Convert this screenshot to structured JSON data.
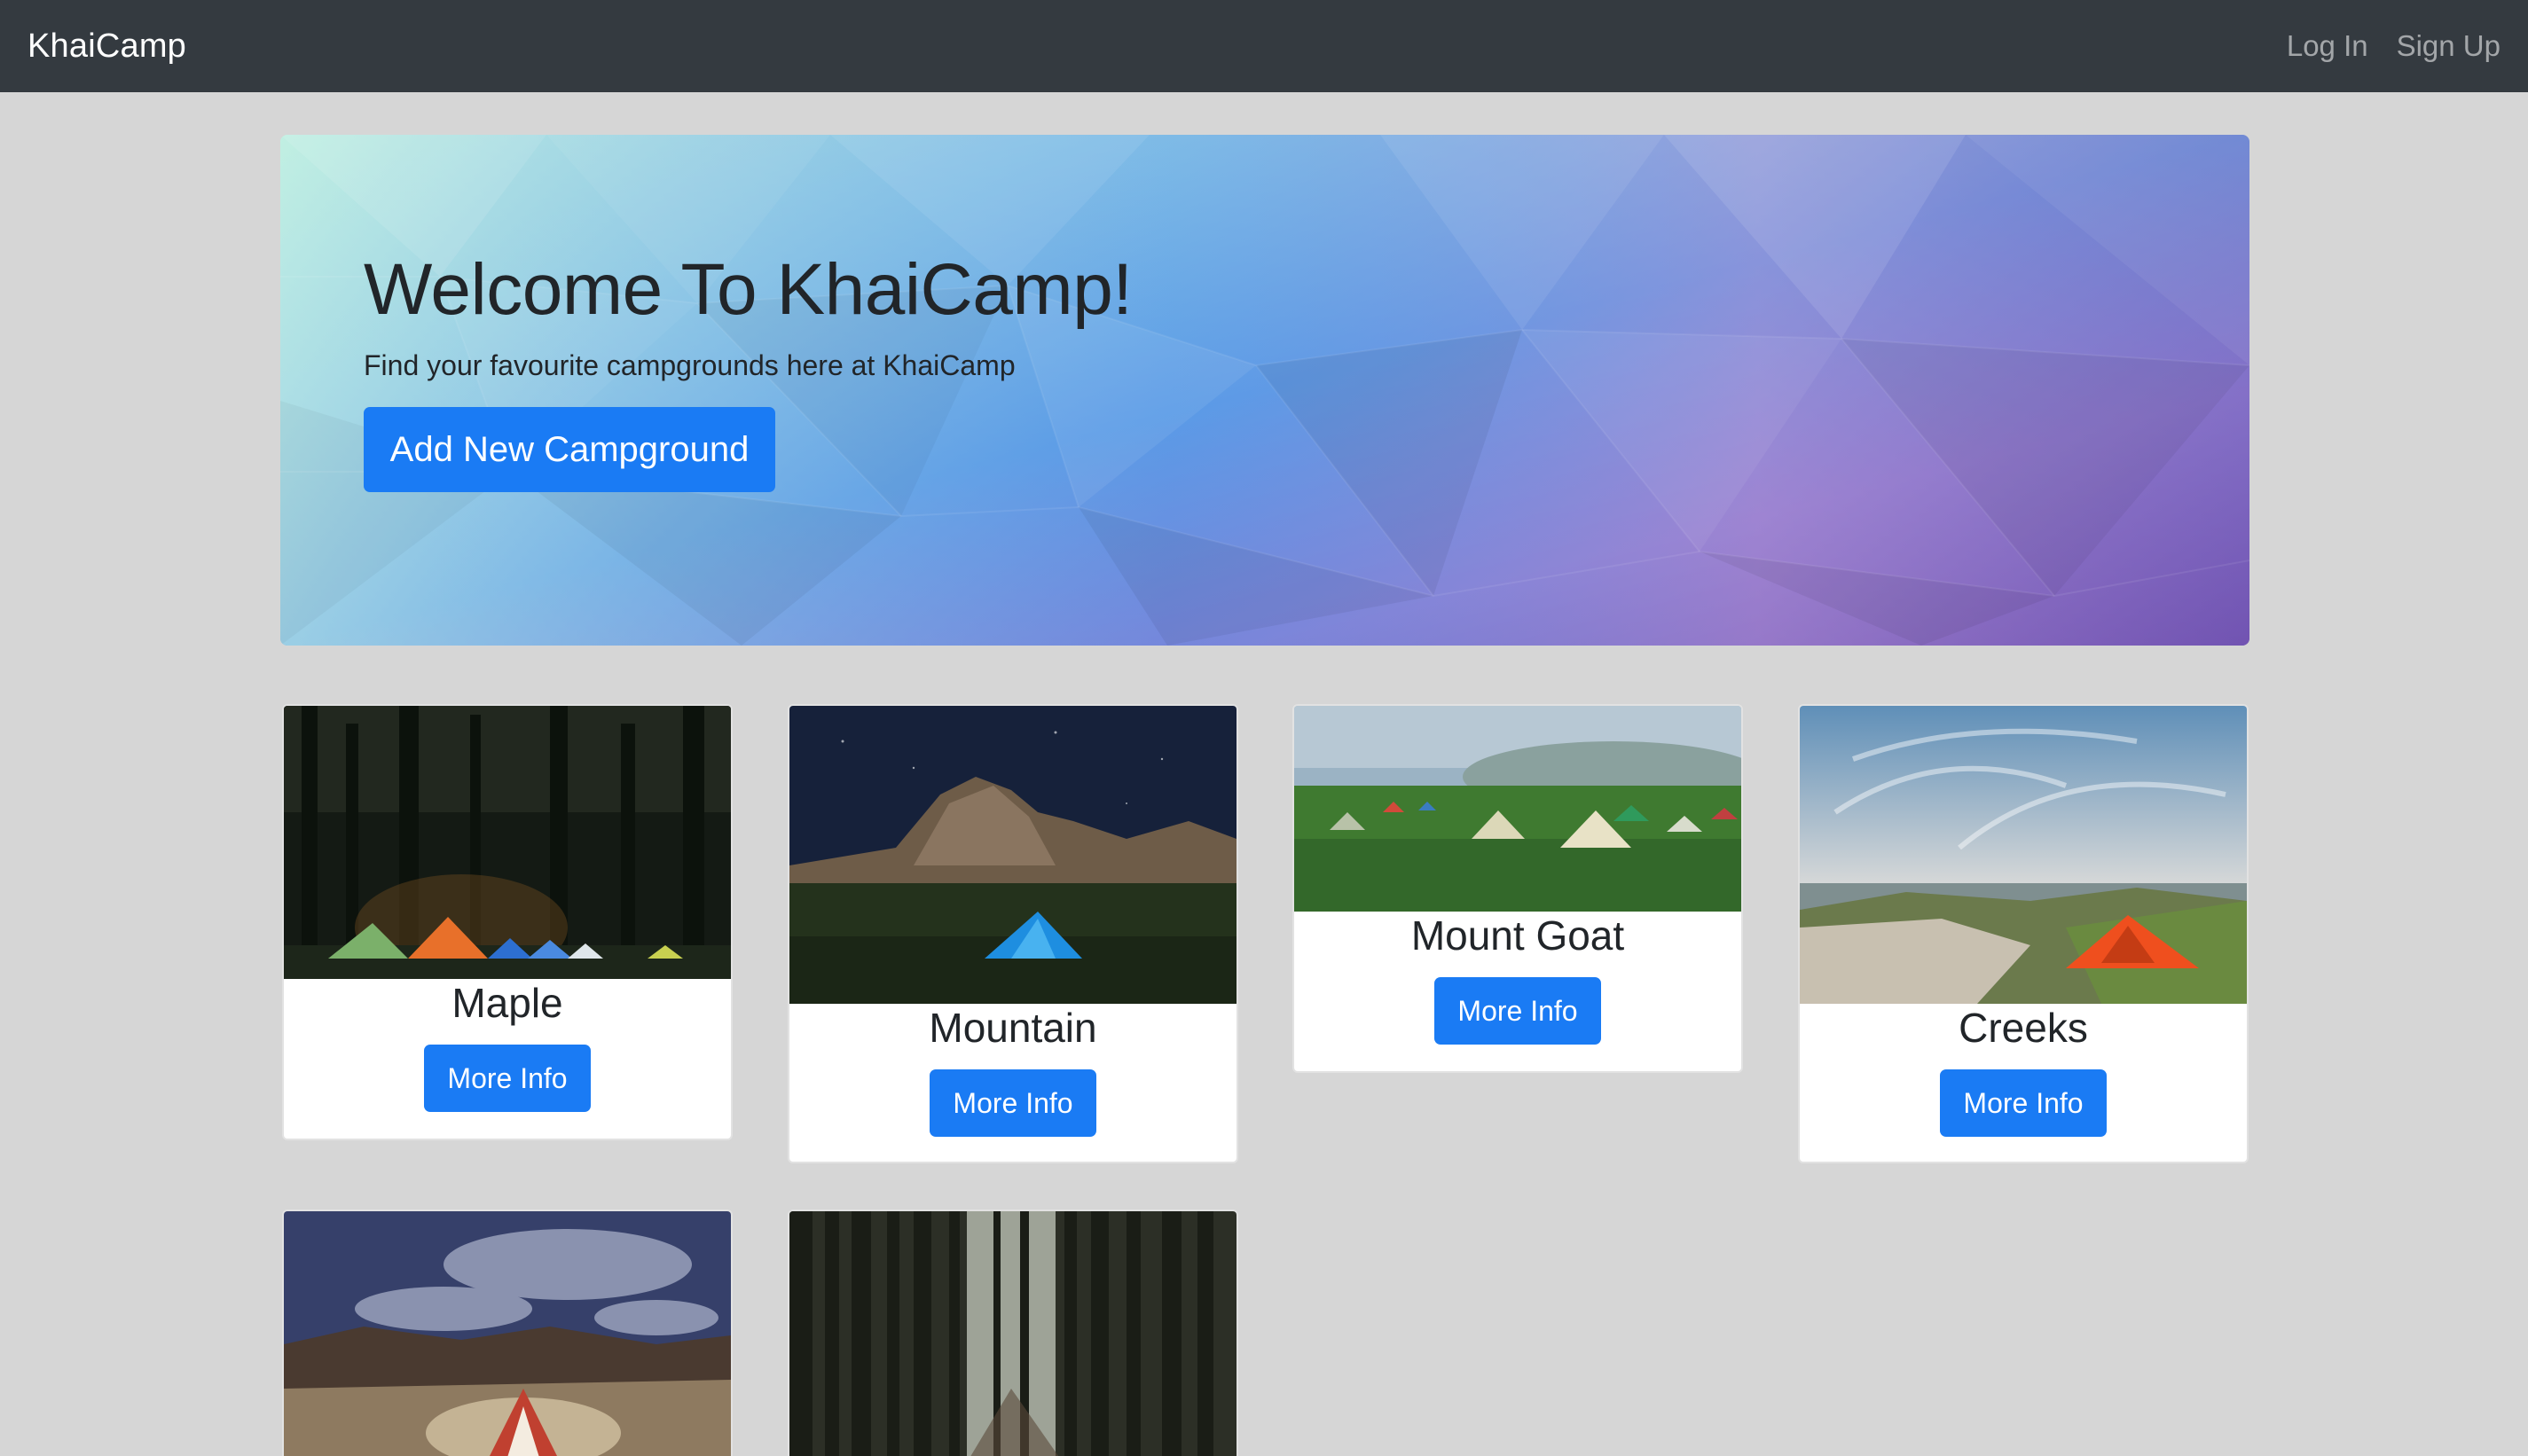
{
  "navbar": {
    "brand": "KhaiCamp",
    "login": "Log In",
    "signup": "Sign Up"
  },
  "jumbotron": {
    "title": "Welcome To KhaiCamp!",
    "subtitle": "Find your favourite campgrounds here at KhaiCamp",
    "button": "Add New Campground"
  },
  "campgrounds": [
    {
      "name": "Maple",
      "button": "More Info"
    },
    {
      "name": "Mountain",
      "button": "More Info"
    },
    {
      "name": "Mount Goat",
      "button": "More Info"
    },
    {
      "name": "Creeks",
      "button": "More Info"
    },
    {
      "name": "",
      "button": ""
    },
    {
      "name": "",
      "button": ""
    }
  ],
  "colors": {
    "navbar": "#343a40",
    "primary": "#1a7bf4",
    "page_bg": "#d6d6d6"
  }
}
